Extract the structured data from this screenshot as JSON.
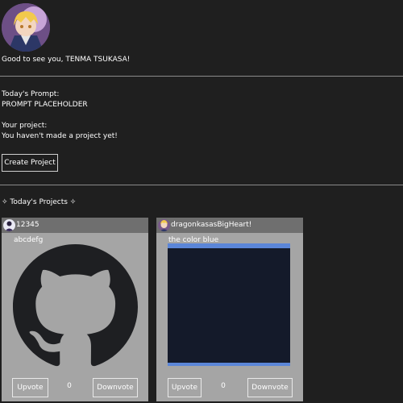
{
  "user": {
    "greeting": "Good to see you, TENMA TSUKASA!"
  },
  "prompt": {
    "heading": "Today's Prompt:",
    "text": "PROMPT PLACEHOLDER"
  },
  "project": {
    "heading": "Your project:",
    "status": "You haven't made a project yet!",
    "create_label": "Create Project"
  },
  "projects_section": {
    "title": "✧ Today's Projects ✧"
  },
  "cards": [
    {
      "author": "12345",
      "title": "abcdefg",
      "upvote_label": "Upvote",
      "votes": "0",
      "downvote_label": "Downvote"
    },
    {
      "author": "dragonkasasBigHeart!",
      "title": "the color blue",
      "upvote_label": "Upvote",
      "votes": "0",
      "downvote_label": "Downvote"
    }
  ],
  "colors": {
    "background": "#1f1f1f",
    "card": "#a5a5a5",
    "card_header": "#6f6f6f",
    "canvas_fill": "#141a2a",
    "canvas_border": "#5b86d8"
  }
}
